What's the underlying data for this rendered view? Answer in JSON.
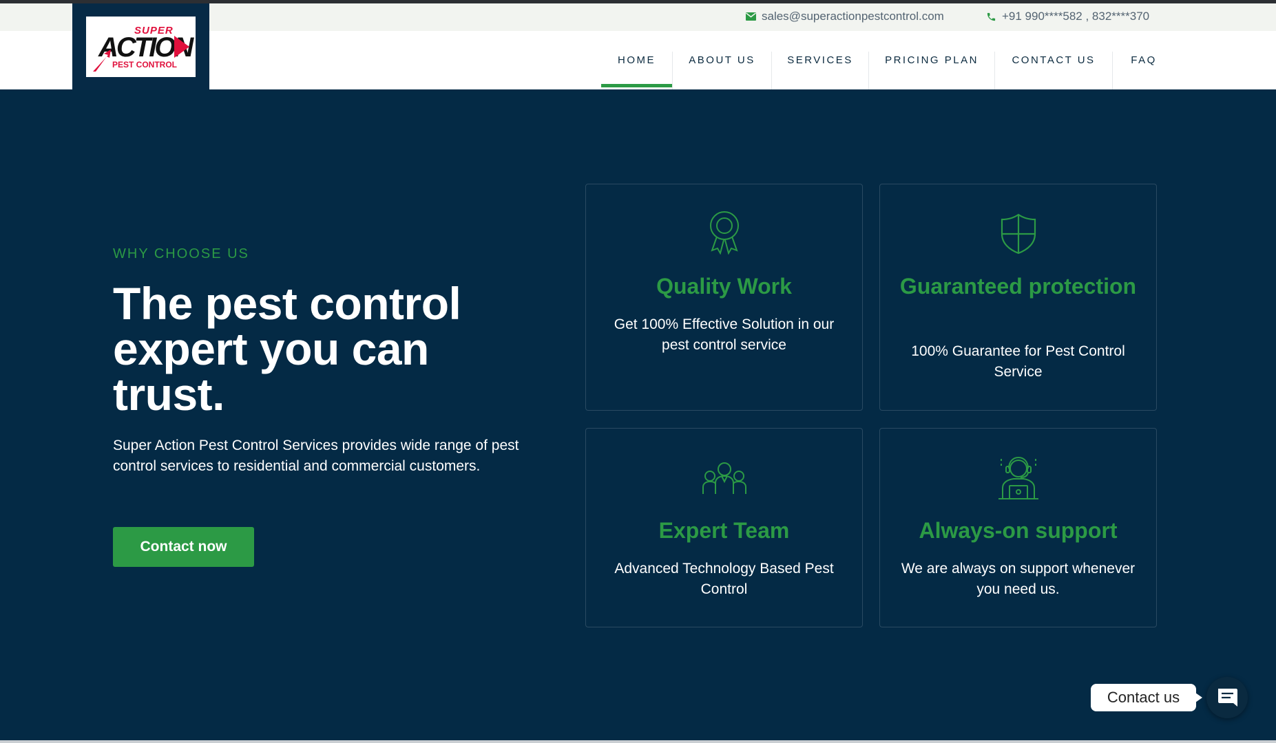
{
  "header": {
    "email": "sales@superactionpestcontrol.com",
    "phone": "+91 990****582 , 832****370",
    "logo": {
      "line1": "SUPER",
      "line2": "ACTION",
      "line3": "PEST CONTROL"
    }
  },
  "nav": {
    "items": [
      {
        "label": "HOME",
        "active": true
      },
      {
        "label": "ABOUT US"
      },
      {
        "label": "SERVICES"
      },
      {
        "label": "PRICING PLAN"
      },
      {
        "label": "CONTACT US"
      },
      {
        "label": "FAQ"
      }
    ]
  },
  "hero": {
    "eyebrow": "WHY CHOOSE US",
    "headline": "The pest control expert you can trust.",
    "description": "Super Action Pest Control Services provides wide range of pest control services to residential and commercial customers.",
    "cta_label": "Contact now"
  },
  "features": [
    {
      "icon": "award-ribbon-icon",
      "title": "Quality Work",
      "text": "Get 100% Effective Solution in our pest control service"
    },
    {
      "icon": "shield-icon",
      "title": "Guaranteed protection",
      "text": "100% Guarantee for Pest Control Service"
    },
    {
      "icon": "team-icon",
      "title": "Expert Team",
      "text": "Advanced Technology Based Pest Control"
    },
    {
      "icon": "support-agent-icon",
      "title": "Always-on support",
      "text": "We are always on support whenever you need us."
    }
  ],
  "chat_widget": {
    "label": "Contact us",
    "icon": "chat-icon"
  },
  "colors": {
    "brand_green": "#2c9a45",
    "navy": "#042a45",
    "logo_red": "#e0103c"
  }
}
